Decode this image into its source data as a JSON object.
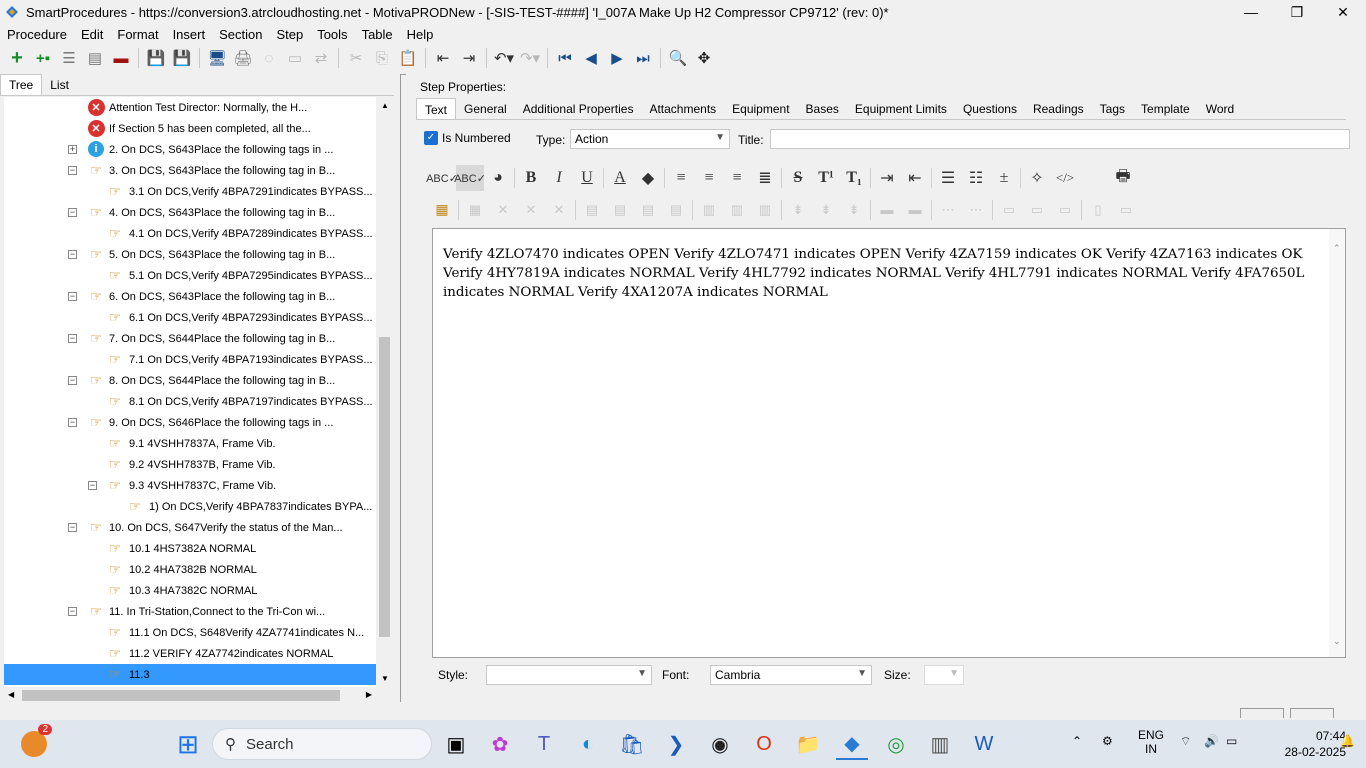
{
  "window": {
    "title": "SmartProcedures - https://conversion3.atrcloudhosting.net - MotivaPRODNew - [-SIS-TEST-####] 'I_007A Make Up H2 Compressor CP9712' (rev: 0)*"
  },
  "menu": [
    "Procedure",
    "Edit",
    "Format",
    "Insert",
    "Section",
    "Step",
    "Tools",
    "Table",
    "Help"
  ],
  "left_tabs": [
    "Tree",
    "List"
  ],
  "tree": [
    {
      "text": "Attention Test Director: Normally, the H...",
      "icon": "error-icon",
      "level": 0,
      "exp": ""
    },
    {
      "text": "If Section 5 has been completed, all the...",
      "icon": "error-icon",
      "level": 0,
      "exp": ""
    },
    {
      "text": "2. On DCS, S643Place the following tags in ...",
      "icon": "info-icon",
      "level": 0,
      "exp": "+"
    },
    {
      "text": "3. On DCS, S643Place the following tag in B...",
      "icon": "hand-icon",
      "level": 0,
      "exp": "−"
    },
    {
      "text": "3.1  On DCS,Verify  4BPA7291indicates  BYPASS...",
      "icon": "hand-icon",
      "level": 1,
      "exp": ""
    },
    {
      "text": "4. On DCS, S643Place the following tag in B...",
      "icon": "hand-icon",
      "level": 0,
      "exp": "−"
    },
    {
      "text": "4.1  On DCS,Verify  4BPA7289indicates  BYPASS...",
      "icon": "hand-icon",
      "level": 1,
      "exp": ""
    },
    {
      "text": "5. On DCS, S643Place the following tag in B...",
      "icon": "hand-icon",
      "level": 0,
      "exp": "−"
    },
    {
      "text": "5.1  On DCS,Verify  4BPA7295indicates  BYPASS...",
      "icon": "hand-icon",
      "level": 1,
      "exp": ""
    },
    {
      "text": "6. On DCS, S643Place the following tag in B...",
      "icon": "hand-icon",
      "level": 0,
      "exp": "−"
    },
    {
      "text": "6.1  On DCS,Verify  4BPA7293indicates  BYPASS...",
      "icon": "hand-icon",
      "level": 1,
      "exp": ""
    },
    {
      "text": "7. On DCS, S644Place the following tag in B...",
      "icon": "hand-icon",
      "level": 0,
      "exp": "−"
    },
    {
      "text": "7.1  On DCS,Verify  4BPA7193indicates  BYPASS...",
      "icon": "hand-icon",
      "level": 1,
      "exp": ""
    },
    {
      "text": "8. On DCS, S644Place the following tag in B...",
      "icon": "hand-icon",
      "level": 0,
      "exp": "−"
    },
    {
      "text": "8.1  On DCS,Verify  4BPA7197indicates  BYPASS...",
      "icon": "hand-icon",
      "level": 1,
      "exp": ""
    },
    {
      "text": "9. On DCS, S646Place the following tags in ...",
      "icon": "hand-icon",
      "level": 0,
      "exp": "−"
    },
    {
      "text": "9.1 4VSHH7837A, Frame Vib.",
      "icon": "hand-icon",
      "level": 1,
      "exp": ""
    },
    {
      "text": "9.2 4VSHH7837B, Frame Vib.",
      "icon": "hand-icon",
      "level": 1,
      "exp": ""
    },
    {
      "text": "9.3 4VSHH7837C, Frame Vib.",
      "icon": "hand-icon",
      "level": 1,
      "exp": "−"
    },
    {
      "text": "1)  On DCS,Verify  4BPA7837indicates  BYPA...",
      "icon": "hand-icon",
      "level": 2,
      "exp": ""
    },
    {
      "text": "10. On DCS, S647Verify the status of the Man...",
      "icon": "hand-icon",
      "level": 0,
      "exp": "−"
    },
    {
      "text": "10.1 4HS7382A        NORMAL",
      "icon": "hand-icon",
      "level": 1,
      "exp": ""
    },
    {
      "text": "10.2 4HA7382B        NORMAL",
      "icon": "hand-icon",
      "level": 1,
      "exp": ""
    },
    {
      "text": "10.3 4HA7382C        NORMAL",
      "icon": "hand-icon",
      "level": 1,
      "exp": ""
    },
    {
      "text": "11. In Tri-Station,Connect to the Tri-Con wi...",
      "icon": "hand-icon",
      "level": 0,
      "exp": "−"
    },
    {
      "text": "11.1  On DCS,  S648Verify  4ZA7741indicates  N...",
      "icon": "hand-icon",
      "level": 1,
      "exp": ""
    },
    {
      "text": "11.2 VERIFY 4ZA7742indicates NORMAL",
      "icon": "hand-icon",
      "level": 1,
      "exp": ""
    },
    {
      "text": "11.3",
      "icon": "hand-icon",
      "level": 1,
      "exp": "",
      "selected": true
    }
  ],
  "step_properties_label": "Step Properties:",
  "right_tabs": [
    "Text",
    "General",
    "Additional Properties",
    "Attachments",
    "Equipment",
    "Bases",
    "Equipment Limits",
    "Questions",
    "Readings",
    "Tags",
    "Template",
    "Word"
  ],
  "is_numbered_label": "Is Numbered",
  "type_label": "Type:",
  "type_value": "Action",
  "title_label": "Title:",
  "title_value": "",
  "editor_text": "Verify 4ZLO7470  indicates OPEN Verify 4ZLO7471  indicates OPEN Verify 4ZA7159  indicates OK Verify 4ZA7163  indicates OK Verify 4HY7819A  indicates NORMAL Verify 4HL7792  indicates NORMAL Verify 4HL7791  indicates NORMAL Verify 4FA7650L  indicates NORMAL Verify 4XA1207A  indicates NORMAL",
  "style_label": "Style:",
  "style_value": "",
  "font_label": "Font:",
  "font_value": "Cambria",
  "size_label": "Size:",
  "size_value": "",
  "taskbar": {
    "search_label": "Search",
    "notification_count": "2",
    "lang": "ENG",
    "region": "IN",
    "time": "07:44",
    "date": "28-02-2025"
  }
}
